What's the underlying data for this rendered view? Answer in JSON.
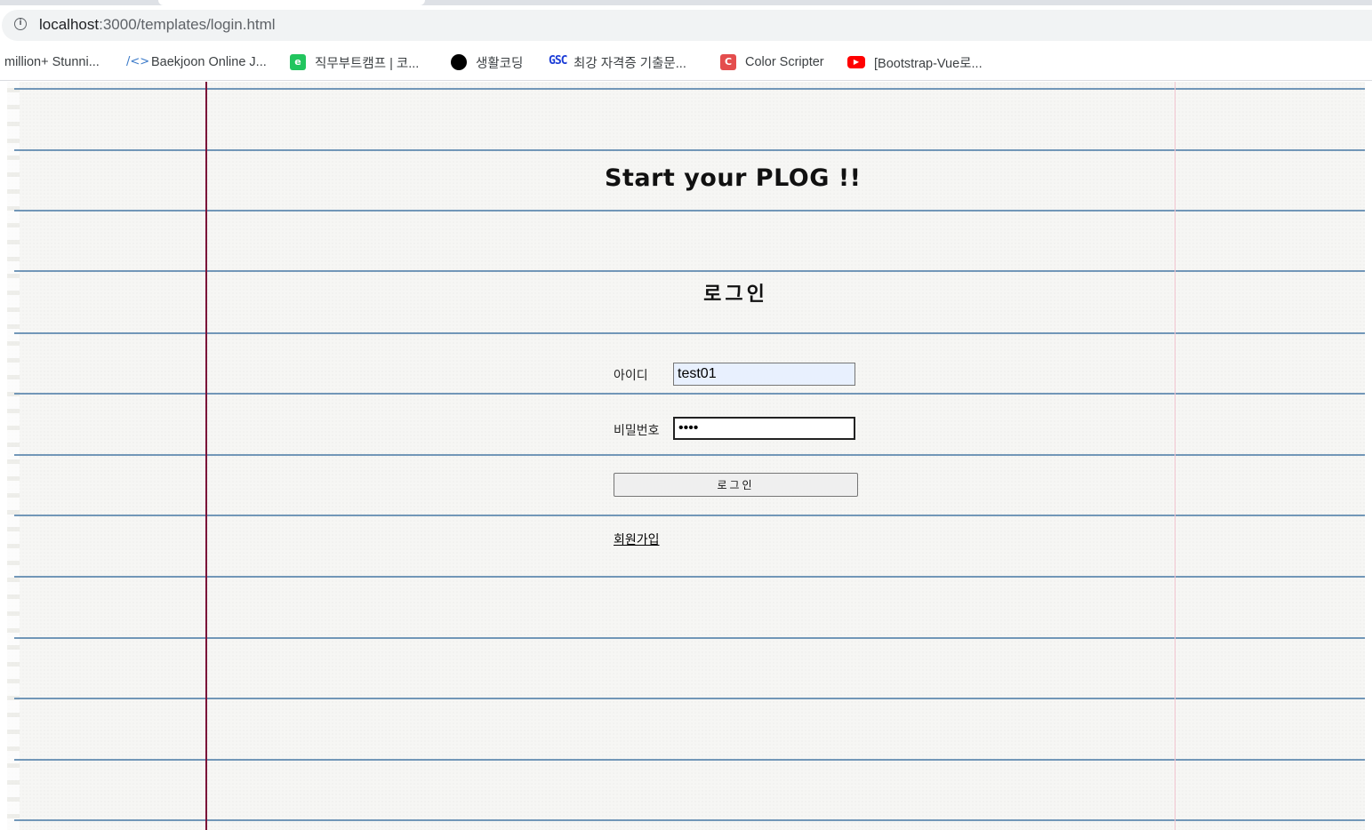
{
  "browser": {
    "url_host": "localhost",
    "url_path": ":3000/templates/login.html"
  },
  "bookmarks": [
    {
      "label": "million+ Stunni...",
      "icon": "none"
    },
    {
      "label": "Baekjoon Online J...",
      "icon": "code-icon"
    },
    {
      "label": "직무부트캠프 | 코...",
      "icon": "green-logo-icon"
    },
    {
      "label": "생활코딩",
      "icon": "black-circle-icon"
    },
    {
      "label": "최강 자격증 기출문...",
      "icon": "gsc-logo-icon"
    },
    {
      "label": "Color Scripter",
      "icon": "color-scripter-icon"
    },
    {
      "label": "[Bootstrap-Vue로...",
      "icon": "youtube-icon"
    }
  ],
  "page": {
    "title": "Start your PLOG !!",
    "login_heading": "로그인",
    "form": {
      "id_label": "아이디",
      "id_value": "test01",
      "password_label": "비밀번호",
      "password_value": "••••",
      "submit_label": "로그인"
    },
    "signup_link": "회원가입"
  },
  "colors": {
    "paper": "#f6f6f4",
    "rule_line": "#5b86ad",
    "margin_line": "#7a1338",
    "autofill_bg": "#e8f0fe"
  }
}
